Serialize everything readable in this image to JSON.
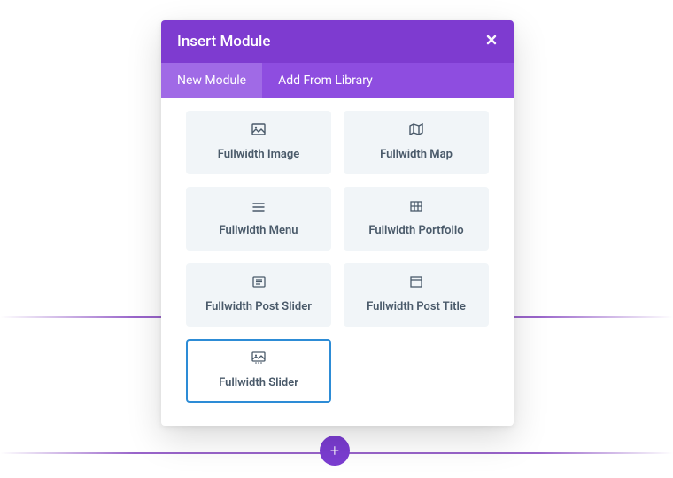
{
  "modal": {
    "title": "Insert Module",
    "tabs": {
      "new": "New Module",
      "library": "Add From Library"
    }
  },
  "modules": {
    "image": "Fullwidth Image",
    "map": "Fullwidth Map",
    "menu": "Fullwidth Menu",
    "portfolio": "Fullwidth Portfolio",
    "post_slider": "Fullwidth Post Slider",
    "post_title": "Fullwidth Post Title",
    "slider": "Fullwidth Slider"
  },
  "buttons": {
    "plus": "+"
  }
}
